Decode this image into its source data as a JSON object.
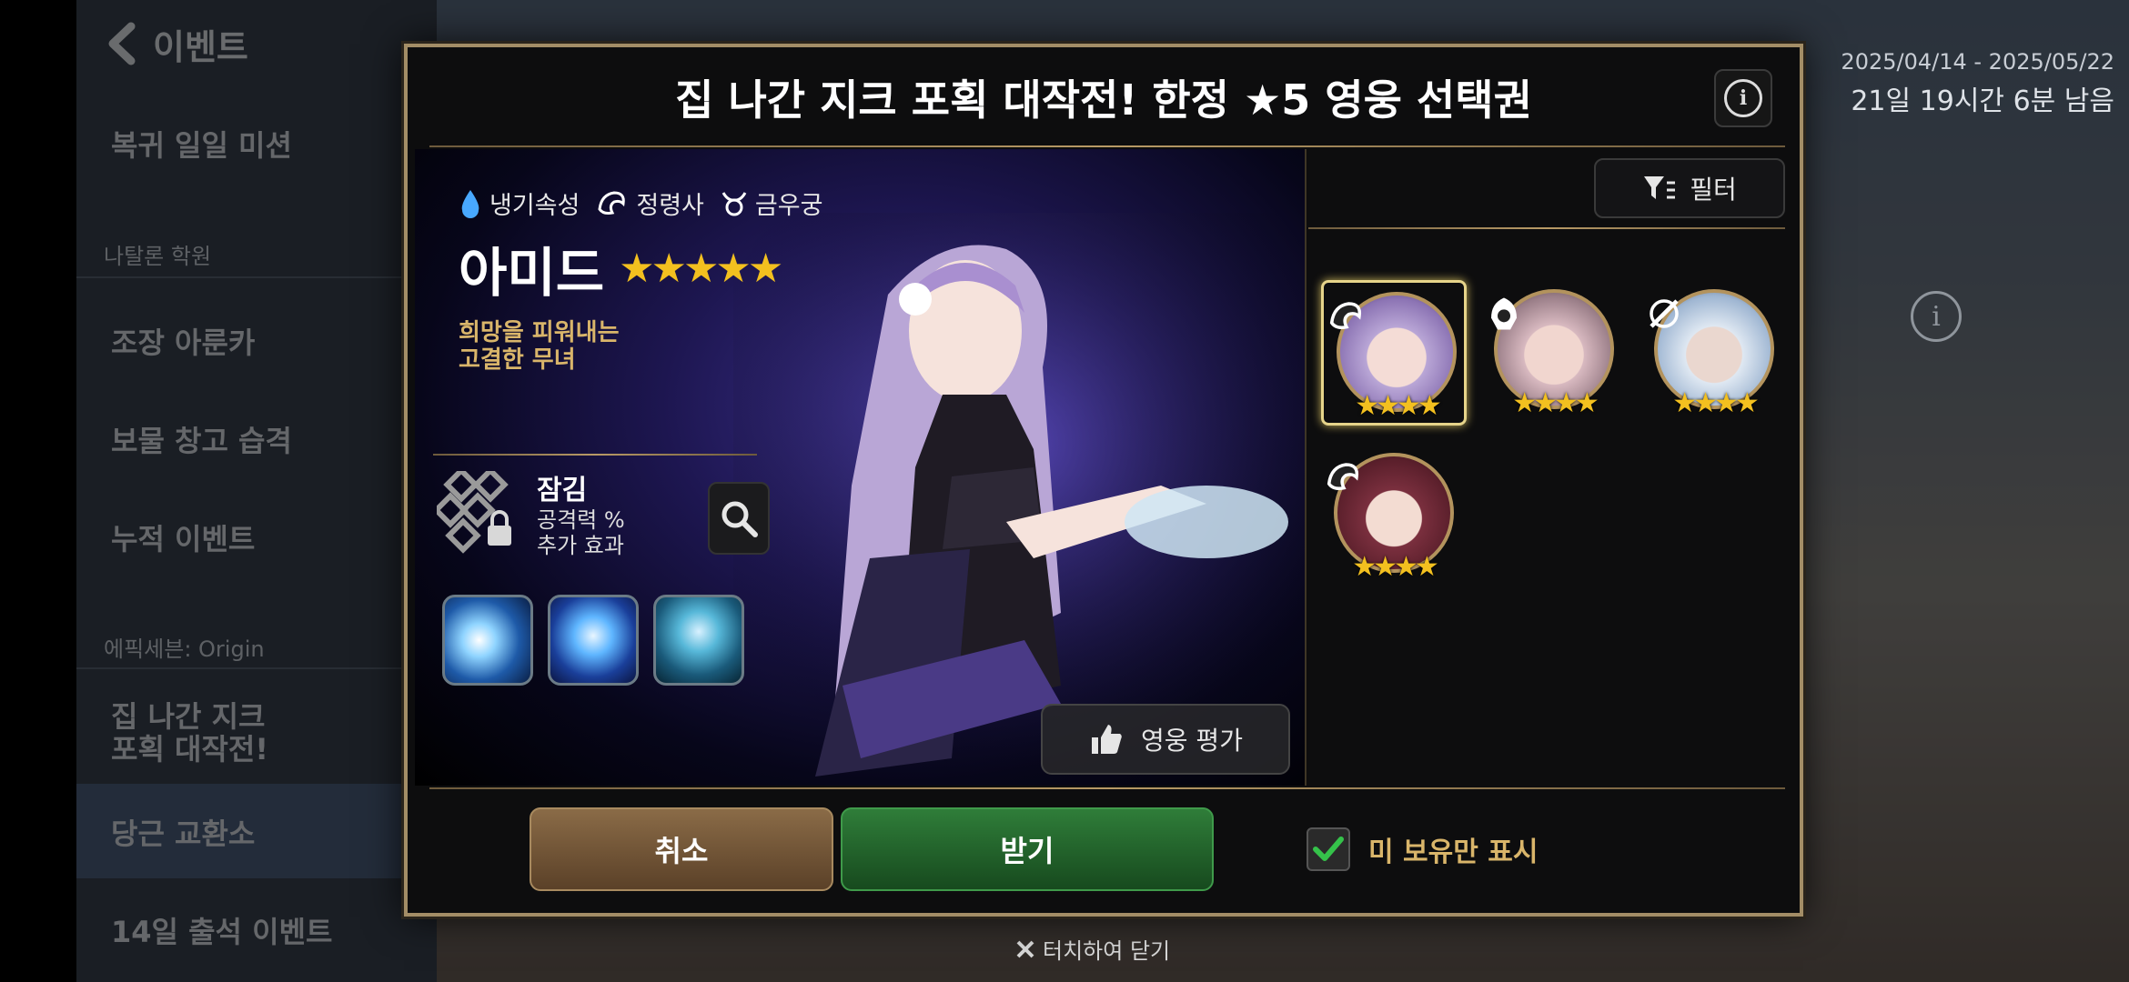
{
  "background": {
    "back_title": "이벤트",
    "date_range": "2025/04/14 - 2025/05/22",
    "time_left": "21일 19시간 6분 남음",
    "event_list": [
      {
        "type": "item",
        "label": "복귀 일일 미션"
      },
      {
        "type": "group",
        "label": "나탈론 학원"
      },
      {
        "type": "item",
        "label": "조장 아룬카"
      },
      {
        "type": "item",
        "label": "보물 창고 습격"
      },
      {
        "type": "item",
        "label": "누적 이벤트"
      },
      {
        "type": "group",
        "label": "에픽세븐: Origin"
      },
      {
        "type": "item",
        "label": "집 나간 지크\n포획 대작전!"
      },
      {
        "type": "item",
        "label": "당근 교환소"
      },
      {
        "type": "item",
        "label": "14일 출석 이벤트"
      }
    ],
    "close_hint": "터치하여 닫기"
  },
  "dialog": {
    "title": "집 나간 지크 포획 대작전! 한정 ★5 영웅 선택권",
    "hero": {
      "element": "냉기속성",
      "class": "정령사",
      "zodiac": "금우궁",
      "name": "아미드",
      "stars": "★★★★★",
      "subtitle": "희망을 피워내는\n고결한 무녀",
      "artifact_title": "잠김",
      "artifact_desc1": "공격력 %",
      "artifact_desc2": "추가 효과",
      "rate_label": "영웅 평가"
    },
    "filter_label": "필터",
    "portraits": [
      {
        "name": "portrait-amid",
        "stars": "★★★★",
        "selected": true
      },
      {
        "name": "portrait-hero-2",
        "stars": "★★★★",
        "selected": false
      },
      {
        "name": "portrait-hero-3",
        "stars": "★★★★",
        "selected": false
      },
      {
        "name": "portrait-hero-4",
        "stars": "★★★★",
        "selected": false
      }
    ],
    "cancel_label": "취소",
    "receive_label": "받기",
    "unowned_label": "미 보유만 표시"
  },
  "colors": {
    "gold": "#b89a66",
    "star": "#f3c01f",
    "receive_green": "#2f7d39",
    "cancel_brown": "#8a6b47"
  }
}
